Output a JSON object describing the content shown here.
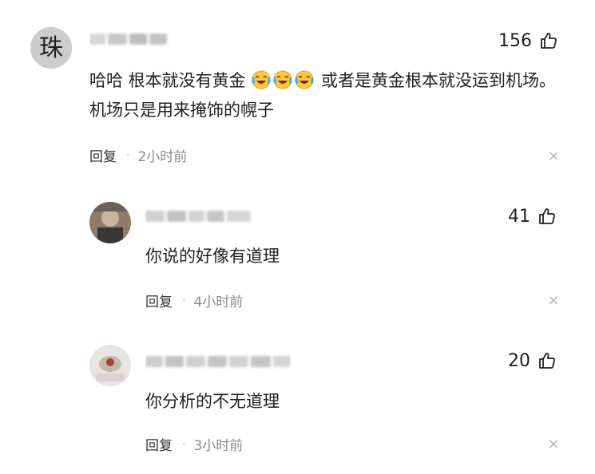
{
  "comments": [
    {
      "avatar_char": "珠",
      "likes": "156",
      "text_before": "哈哈 根本就没有黄金 ",
      "emoji": [
        "crying-laughing-emoji",
        "crying-laughing-emoji",
        "crying-laughing-emoji"
      ],
      "text_after": " 或者是黄金根本就没运到机场。机场只是用来掩饰的幌子",
      "reply_label": "回复",
      "time": "2小时前"
    },
    {
      "likes": "41",
      "text": "你说的好像有道理",
      "reply_label": "回复",
      "time": "4小时前"
    },
    {
      "likes": "20",
      "text": "你分析的不无道理",
      "reply_label": "回复",
      "time": "3小时前"
    }
  ],
  "close_glyph": "×",
  "colors": {
    "accent_text": "#222222",
    "muted": "#8a8a8a",
    "emoji_yellow": "#ffc93c"
  }
}
